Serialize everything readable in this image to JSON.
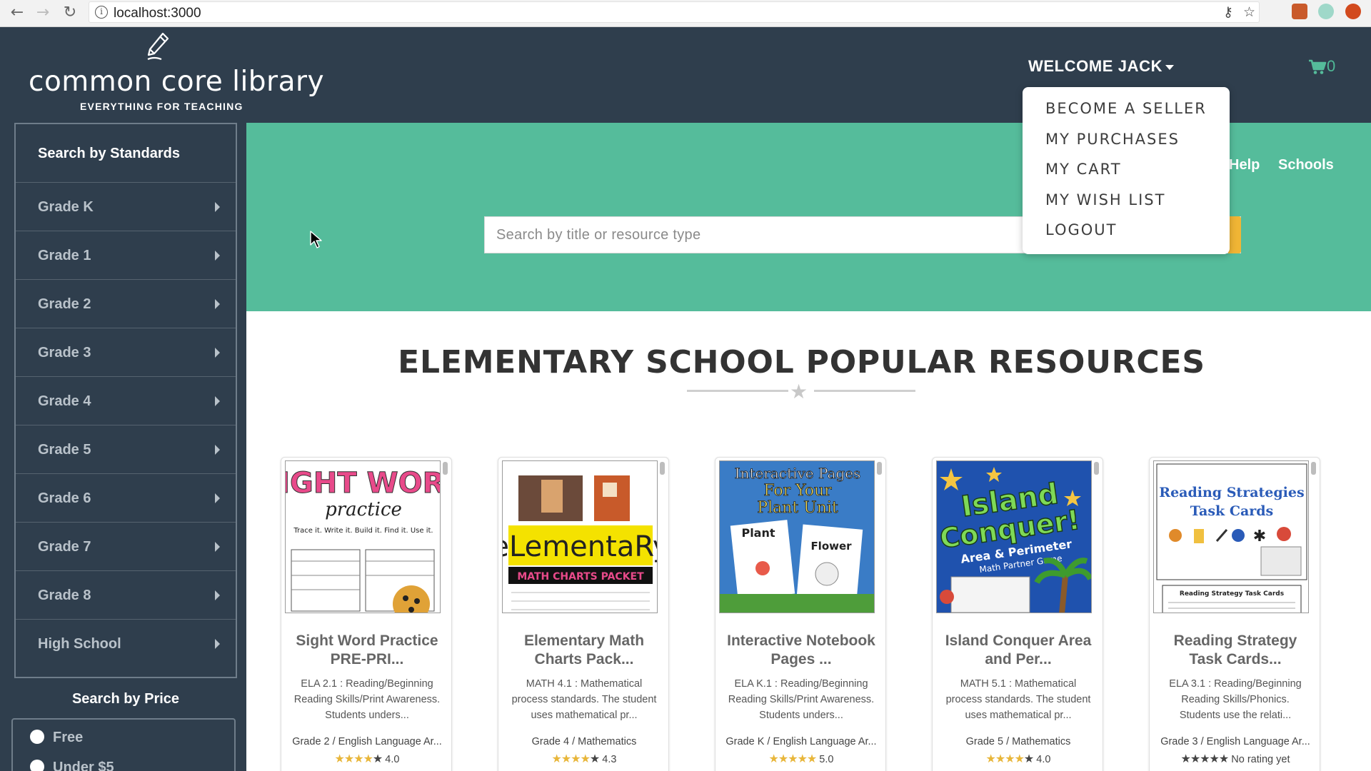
{
  "browser": {
    "url": "localhost:3000",
    "info_glyph": "i",
    "back_glyph": "←",
    "forward_glyph": "→",
    "reload_glyph": "↻",
    "key_glyph": "⚷",
    "star_glyph": "☆"
  },
  "header": {
    "logo_text": "common core library",
    "tagline": "EVERYTHING FOR TEACHING",
    "welcome": "WELCOME JACK",
    "cart_count": "0",
    "accent_color": "#55bc9b"
  },
  "user_menu": {
    "items": [
      {
        "label": "BECOME A SELLER"
      },
      {
        "label": "MY PURCHASES"
      },
      {
        "label": "MY CART"
      },
      {
        "label": "MY WISH LIST"
      },
      {
        "label": "LOGOUT"
      }
    ]
  },
  "sidebar": {
    "title": "Search by Standards",
    "grades": [
      {
        "label": "Grade K"
      },
      {
        "label": "Grade 1"
      },
      {
        "label": "Grade 2"
      },
      {
        "label": "Grade 3"
      },
      {
        "label": "Grade 4"
      },
      {
        "label": "Grade 5"
      },
      {
        "label": "Grade 6"
      },
      {
        "label": "Grade 7"
      },
      {
        "label": "Grade 8"
      },
      {
        "label": "High School"
      }
    ],
    "price_title": "Search by Price",
    "price_options": [
      {
        "label": "Free"
      },
      {
        "label": "Under $5"
      }
    ]
  },
  "hero": {
    "links": [
      {
        "label": "Help"
      },
      {
        "label": "Schools"
      }
    ],
    "search_placeholder": "Search by title or resource type"
  },
  "main": {
    "section_title": "ELEMENTARY SCHOOL POPULAR RESOURCES"
  },
  "products": [
    {
      "title": "Sight Word Practice PRE-PRI...",
      "description": "ELA 2.1 : Reading/Beginning Reading Skills/Print Awareness. Students unders...",
      "grade": "Grade 2 / English Language Ar...",
      "stars": 4,
      "rating": "4.0",
      "thumb_lines": [
        "SIGHT WORD",
        "practice",
        "Trace it. Write it. Build it. Find it. Use it."
      ]
    },
    {
      "title": "Elementary Math Charts Pack...",
      "description": "MATH 4.1 : Mathematical process standards. The student uses mathematical pr...",
      "grade": "Grade 4 / Mathematics",
      "stars": 4,
      "rating": "4.3",
      "thumb_lines": [
        "eLementaRy",
        "MATH CHARTS PACKET"
      ]
    },
    {
      "title": "Interactive Notebook Pages ...",
      "description": "ELA K.1 : Reading/Beginning Reading Skills/Print Awareness. Students unders...",
      "grade": "Grade K / English Language Ar...",
      "stars": 5,
      "rating": "5.0",
      "thumb_lines": [
        "Interactive Pages",
        "For Your",
        "Plant Unit",
        "Plant",
        "Flower"
      ]
    },
    {
      "title": "Island Conquer Area and Per...",
      "description": "MATH 5.1 : Mathematical process standards. The student uses mathematical pr...",
      "grade": "Grade 5 / Mathematics",
      "stars": 4,
      "rating": "4.0",
      "thumb_lines": [
        "Island",
        "Conquer!",
        "Area & Perimeter",
        "Math Partner Game"
      ]
    },
    {
      "title": "Reading Strategy Task Cards...",
      "description": "ELA 3.1 : Reading/Beginning Reading Skills/Phonics. Students use the relati...",
      "grade": "Grade 3 / English Language Ar...",
      "stars": 0,
      "rating": "No rating yet",
      "thumb_lines": [
        "Reading Strategies",
        "Task Cards",
        "Reading Strategy Task Cards"
      ]
    }
  ]
}
